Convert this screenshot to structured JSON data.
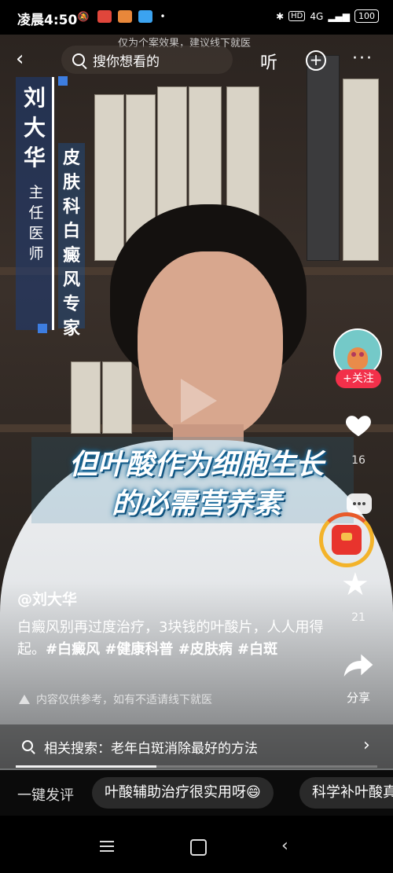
{
  "status_bar": {
    "time": "凌晨4:50",
    "network": "4G",
    "signal": "HD",
    "battery": "100"
  },
  "top_bar": {
    "disclaimer": "仅为个案效果，建议线下就医",
    "search_placeholder": "搜你想看的",
    "listen_label": "听"
  },
  "video_overlay": {
    "doctor_name": "刘大华",
    "doctor_title": "主任医师",
    "specialty": "皮肤科白癜风专家",
    "subtitle_line1": "但叶酸作为细胞生长",
    "subtitle_line2": "的必需营养素"
  },
  "side_rail": {
    "follow_label": "+关注",
    "like_count": "16",
    "favorite_count": "21",
    "share_label": "分享"
  },
  "post": {
    "author": "@刘大华",
    "description": "白癜风别再过度治疗，3块钱的叶酸片，人人用得起。",
    "tags": "#白癜风 #健康科普 #皮肤病 #白斑",
    "content_warning": "内容仅供参考，如有不适请线下就医"
  },
  "related_search": {
    "label": "相关搜索：",
    "query": "老年白斑消除最好的方法"
  },
  "playback": {
    "progress_fraction": 0.39
  },
  "quick_comment": {
    "label": "一键发评",
    "chips": [
      "叶酸辅助治疗很实用呀😄",
      "科学补叶酸真"
    ]
  },
  "colors": {
    "follow_red": "#f2304a",
    "caption_blue": "#3d7de0"
  }
}
